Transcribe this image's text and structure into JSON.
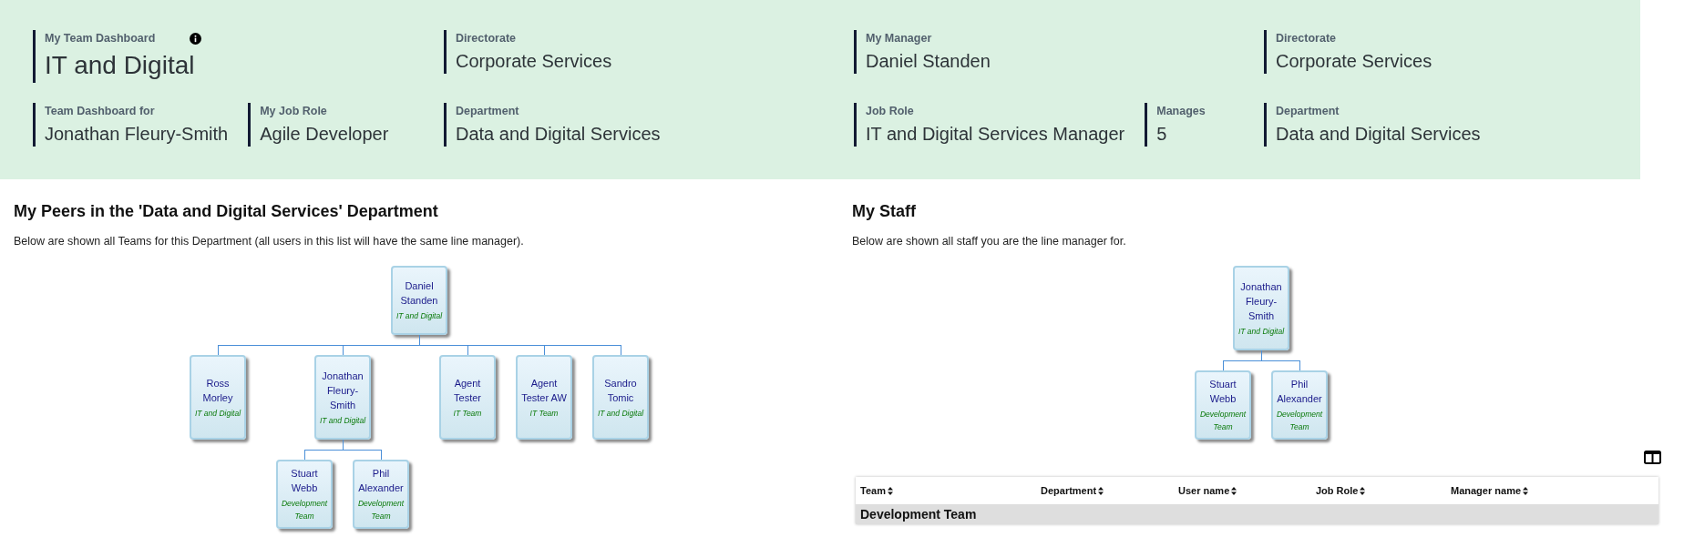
{
  "header": {
    "rows": [
      [
        [
          {
            "kind": "title",
            "label": "My Team Dashboard",
            "value": "IT and Digital",
            "info": true
          }
        ],
        [
          {
            "kind": "field",
            "label": "Directorate",
            "value": "Corporate Services"
          }
        ],
        [
          {
            "kind": "field",
            "label": "My Manager",
            "value": "Daniel Standen"
          }
        ],
        [
          {
            "kind": "field",
            "label": "Directorate",
            "value": "Corporate Services"
          }
        ]
      ],
      [
        [
          {
            "kind": "field",
            "label": "Team Dashboard for",
            "value": "Jonathan Fleury-Smith"
          },
          {
            "kind": "field",
            "label": "My Job Role",
            "value": "Agile Developer"
          }
        ],
        [
          {
            "kind": "field",
            "label": "Department",
            "value": "Data and Digital Services"
          }
        ],
        [
          {
            "kind": "field",
            "label": "Job Role",
            "value": "IT and Digital Services Manager"
          },
          {
            "kind": "field",
            "label": "Manages",
            "value": "5"
          }
        ],
        [
          {
            "kind": "field",
            "label": "Department",
            "value": "Data and Digital Services"
          }
        ]
      ]
    ]
  },
  "peers": {
    "title": "My Peers in the 'Data and Digital Services' Department",
    "description": "Below are shown all Teams for this Department (all users in this list will have the same line manager).",
    "org_chart": {
      "name": "Daniel Standen",
      "team": "IT and Digital",
      "children": [
        {
          "name": "Ross Morley",
          "team": "IT and Digital"
        },
        {
          "name": "Jonathan Fleury-Smith",
          "team": "IT and Digital",
          "children": [
            {
              "name": "Stuart Webb",
              "team": "Development Team"
            },
            {
              "name": "Phil Alexander",
              "team": "Development Team"
            }
          ]
        },
        {
          "name": "Agent Tester",
          "team": "IT Team"
        },
        {
          "name": "Agent Tester AW",
          "team": "IT Team"
        },
        {
          "name": "Sandro Tomic",
          "team": "IT and Digital"
        }
      ]
    }
  },
  "staff": {
    "title": "My Staff",
    "description": "Below are shown all staff you are the line manager for.",
    "org_chart": {
      "name": "Jonathan Fleury-Smith",
      "team": "IT and Digital",
      "children": [
        {
          "name": "Stuart Webb",
          "team": "Development Team"
        },
        {
          "name": "Phil Alexander",
          "team": "Development Team"
        }
      ]
    },
    "table": {
      "columns": [
        "Team",
        "Department",
        "User name",
        "Job Role",
        "Manager name"
      ],
      "group_rows": [
        "Development Team"
      ]
    }
  }
}
